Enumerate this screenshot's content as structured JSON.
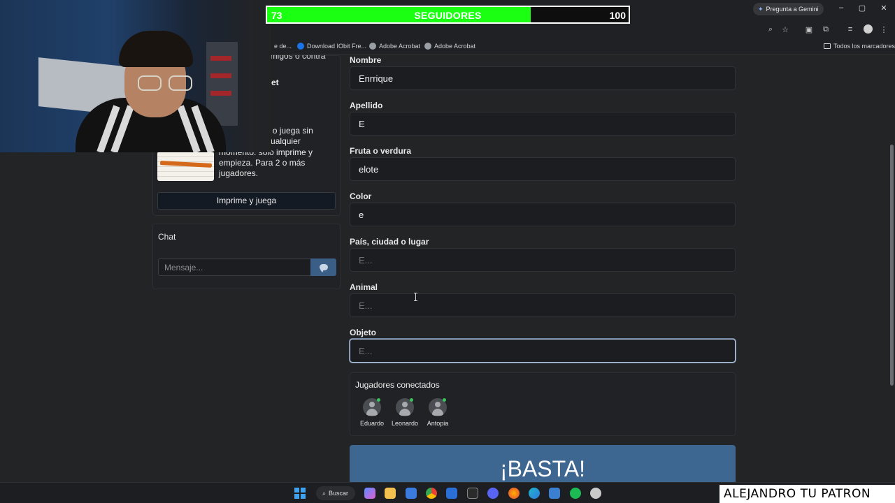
{
  "browser": {
    "gemini_label": "Pregunta a Gemini",
    "window_controls": [
      "–",
      "▢",
      "✕"
    ],
    "bookmarks": [
      {
        "label": "e de..."
      },
      {
        "label": "Download IObit Fre..."
      },
      {
        "label": "Adobe Acrobat"
      },
      {
        "label": "Adobe Acrobat"
      }
    ],
    "all_bookmarks_label": "Todos los marcadores"
  },
  "follower_goal": {
    "current": "73",
    "label": "SEGUIDORES",
    "goal": "100",
    "fraction": 0.73,
    "fill_color": "#1bff13"
  },
  "sidebar": {
    "partial_text": "amigos o contra",
    "partial_heading": "et",
    "promo_text": "PDF de juego o juega sin conexión en cualquier momento: solo imprime y empieza. Para 2 o más jugadores.",
    "promo_button": "Imprime y juega",
    "chat": {
      "title": "Chat",
      "placeholder": "Mensaje..."
    }
  },
  "form": {
    "fields": [
      {
        "label": "Nombre",
        "value": "Enrrique",
        "placeholder": ""
      },
      {
        "label": "Apellido",
        "value": "E",
        "placeholder": ""
      },
      {
        "label": "Fruta o verdura",
        "value": "elote",
        "placeholder": ""
      },
      {
        "label": "Color",
        "value": "e",
        "placeholder": ""
      },
      {
        "label": "País, ciudad o lugar",
        "value": "",
        "placeholder": "E..."
      },
      {
        "label": "Animal",
        "value": "",
        "placeholder": "E..."
      },
      {
        "label": "Objeto",
        "value": "",
        "placeholder": "E..."
      }
    ],
    "players_title": "Jugadores conectados",
    "players": [
      {
        "name": "Eduardo"
      },
      {
        "name": "Leonardo"
      },
      {
        "name": "Antopia"
      }
    ],
    "submit_label": "¡BASTA!"
  },
  "taskbar": {
    "search_label": "Buscar"
  },
  "watermark": "ALEJANDRO TU PATRON",
  "colors": {
    "accent": "#3d6690",
    "online": "#3ac25c"
  }
}
